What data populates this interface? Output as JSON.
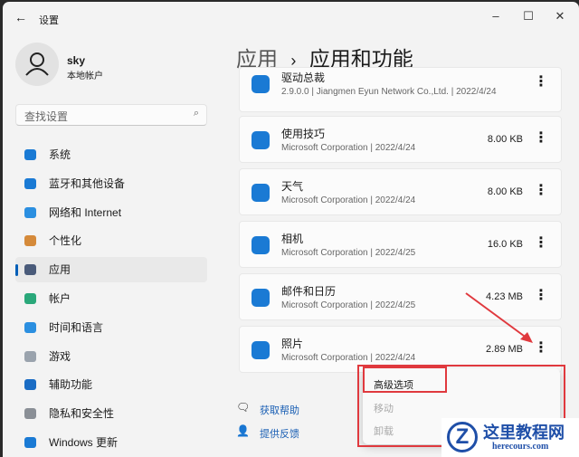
{
  "window": {
    "title": "设置",
    "back_icon": "arrow-left-icon",
    "minimize": "–",
    "maximize": "☐",
    "close": "✕"
  },
  "user": {
    "name": "sky",
    "type": "本地帐户"
  },
  "search": {
    "placeholder": "查找设置"
  },
  "nav": [
    {
      "label": "系统",
      "color": "#1a7ad4"
    },
    {
      "label": "蓝牙和其他设备",
      "color": "#1a7ad4"
    },
    {
      "label": "网络和 Internet",
      "color": "#2b8fe0"
    },
    {
      "label": "个性化",
      "color": "#d58a3a"
    },
    {
      "label": "应用",
      "color": "#4a5b7a",
      "selected": true
    },
    {
      "label": "帐户",
      "color": "#2aa87a"
    },
    {
      "label": "时间和语言",
      "color": "#2b8fe0"
    },
    {
      "label": "游戏",
      "color": "#9aa3ad"
    },
    {
      "label": "辅助功能",
      "color": "#1a6cc4"
    },
    {
      "label": "隐私和安全性",
      "color": "#8a8f96"
    },
    {
      "label": "Windows 更新",
      "color": "#1a7ad4"
    }
  ],
  "breadcrumb": {
    "parent": "应用",
    "sep": "›",
    "current": "应用和功能"
  },
  "apps": [
    {
      "name": "驱动总裁",
      "meta": "2.9.0.0  |  Jiangmen Eyun Network Co.,Ltd.  |  2022/4/24",
      "size": ""
    },
    {
      "name": "使用技巧",
      "meta": "Microsoft Corporation  |  2022/4/24",
      "size": "8.00 KB"
    },
    {
      "name": "天气",
      "meta": "Microsoft Corporation  |  2022/4/24",
      "size": "8.00 KB"
    },
    {
      "name": "相机",
      "meta": "Microsoft Corporation  |  2022/4/25",
      "size": "16.0 KB"
    },
    {
      "name": "邮件和日历",
      "meta": "Microsoft Corporation  |  2022/4/25",
      "size": "4.23 MB"
    },
    {
      "name": "照片",
      "meta": "Microsoft Corporation  |  2022/4/24",
      "size": "2.89 MB"
    }
  ],
  "more_glyph": "⋮",
  "context_menu": {
    "items": [
      "高级选项",
      "移动",
      "卸载"
    ]
  },
  "links": {
    "help": "获取帮助",
    "feedback": "提供反馈"
  },
  "watermark": {
    "title": "这里教程网",
    "url": "herecours.com"
  },
  "accent": "#e0393e"
}
